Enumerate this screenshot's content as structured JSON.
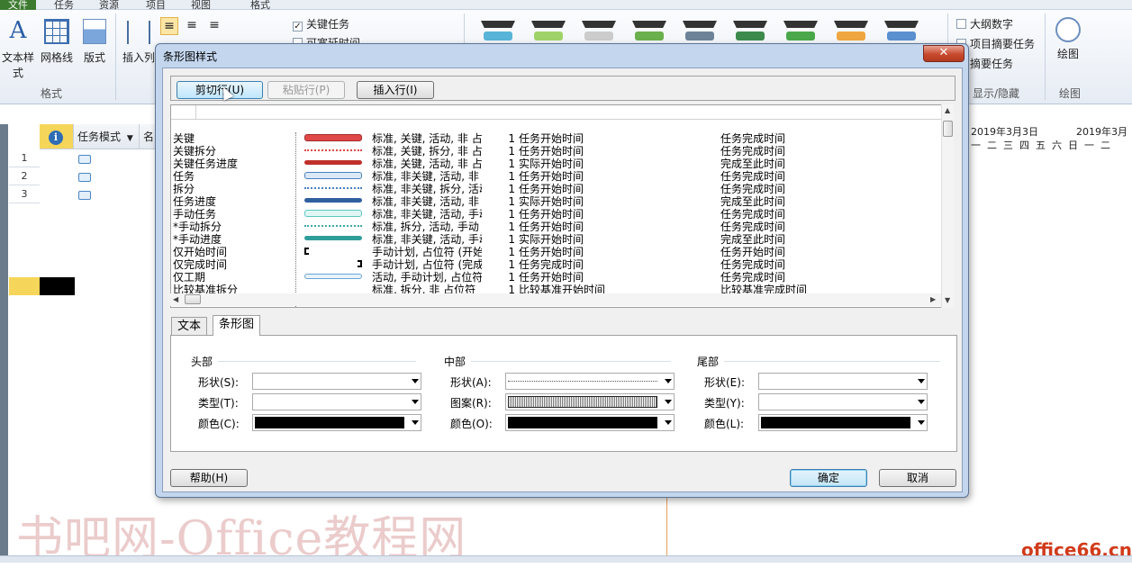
{
  "ribbon": {
    "tabs": [
      "文件",
      "任务",
      "资源",
      "项目",
      "视图",
      "格式"
    ],
    "items": {
      "text_styles": "文本样式",
      "gridlines": "网格线",
      "layout": "版式",
      "insert_column": "插入列",
      "drawing": "绘图"
    },
    "group_labels": {
      "format": "格式",
      "show_hide": "显示/隐藏",
      "drawing": "绘图"
    },
    "checks": {
      "critical_tasks": "关键任务",
      "slack": "可宽延时间",
      "outline_number": "大纲数字",
      "project_summary": "项目摘要任务",
      "summary_tasks": "摘要任务"
    }
  },
  "grid": {
    "column_task_mode": "任务模式",
    "column_name": "名",
    "rows": [
      "1",
      "2",
      "3"
    ],
    "timeline_label_1": "2019年3月3日",
    "timeline_label_2": "2019年3月",
    "weekdays": [
      "一",
      "二",
      "三",
      "四",
      "五",
      "六",
      "日",
      "一",
      "二"
    ]
  },
  "dialog": {
    "title": "条形图样式",
    "close_glyph": "✕",
    "buttons": {
      "cut_row": "剪切行(U)",
      "paste_row": "粘贴行(P)",
      "insert_row": "插入行(I)",
      "help": "帮助(H)",
      "ok": "确定",
      "cancel": "取消"
    },
    "styles": [
      {
        "name": "关键",
        "show": "标准, 关键, 活动, 非 占",
        "row": "1",
        "from": "任务开始时间",
        "to": "任务完成时间",
        "bar": "critical"
      },
      {
        "name": "关键拆分",
        "show": "标准, 关键, 拆分, 非 占",
        "row": "1",
        "from": "任务开始时间",
        "to": "任务完成时间",
        "bar": "critical-split"
      },
      {
        "name": "关键任务进度",
        "show": "标准, 关键, 活动, 非 占",
        "row": "1",
        "from": "实际开始时间",
        "to": "完成至此时间",
        "bar": "critical-progress"
      },
      {
        "name": "任务",
        "show": "标准, 非关键, 活动, 非",
        "row": "1",
        "from": "任务开始时间",
        "to": "任务完成时间",
        "bar": "task"
      },
      {
        "name": "拆分",
        "show": "标准, 非关键, 拆分, 活动",
        "row": "1",
        "from": "任务开始时间",
        "to": "任务完成时间",
        "bar": "split"
      },
      {
        "name": "任务进度",
        "show": "标准, 非关键, 活动, 非",
        "row": "1",
        "from": "实际开始时间",
        "to": "完成至此时间",
        "bar": "progress"
      },
      {
        "name": "手动任务",
        "show": "标准, 非关键, 活动, 手动",
        "row": "1",
        "from": "任务开始时间",
        "to": "任务完成时间",
        "bar": "manual"
      },
      {
        "name": "*手动拆分",
        "show": "标准, 拆分, 活动, 手动",
        "row": "1",
        "from": "任务开始时间",
        "to": "任务完成时间",
        "bar": "manual-split"
      },
      {
        "name": "*手动进度",
        "show": "标准, 非关键, 活动, 手动",
        "row": "1",
        "from": "实际开始时间",
        "to": "完成至此时间",
        "bar": "manual-progress"
      },
      {
        "name": "仅开始时间",
        "show": "手动计划, 占位符 (开始",
        "row": "1",
        "from": "任务开始时间",
        "to": "任务开始时间",
        "bar": "start-only"
      },
      {
        "name": "仅完成时间",
        "show": "手动计划, 占位符 (完成",
        "row": "1",
        "from": "任务完成时间",
        "to": "任务完成时间",
        "bar": "finish-only"
      },
      {
        "name": "仅工期",
        "show": "活动, 手动计划, 占位符",
        "row": "1",
        "from": "任务开始时间",
        "to": "任务完成时间",
        "bar": "duration-only"
      },
      {
        "name": "比较基准拆分",
        "show": "标准, 拆分, 非 占位符",
        "row": "1",
        "from": "比较基准开始时间",
        "to": "比较基准完成时间",
        "bar": "none"
      }
    ],
    "tabs": {
      "text": "文本",
      "bar": "条形图"
    },
    "sections": {
      "start": "头部",
      "middle": "中部",
      "end": "尾部"
    },
    "fields": {
      "start_shape": "形状(S):",
      "start_type": "类型(T):",
      "start_color": "颜色(C):",
      "middle_shape": "形状(A):",
      "middle_pattern": "图案(R):",
      "middle_color": "颜色(O):",
      "end_shape": "形状(E):",
      "end_type": "类型(Y):",
      "end_color": "颜色(L):"
    },
    "colors": {
      "selected_color": "#000000",
      "critical": "#e04848",
      "task": "#4a7fc1",
      "manual": "#5cc6c4"
    }
  },
  "watermark": {
    "left": "书吧网-Office教程网",
    "right": "office66.cn"
  }
}
